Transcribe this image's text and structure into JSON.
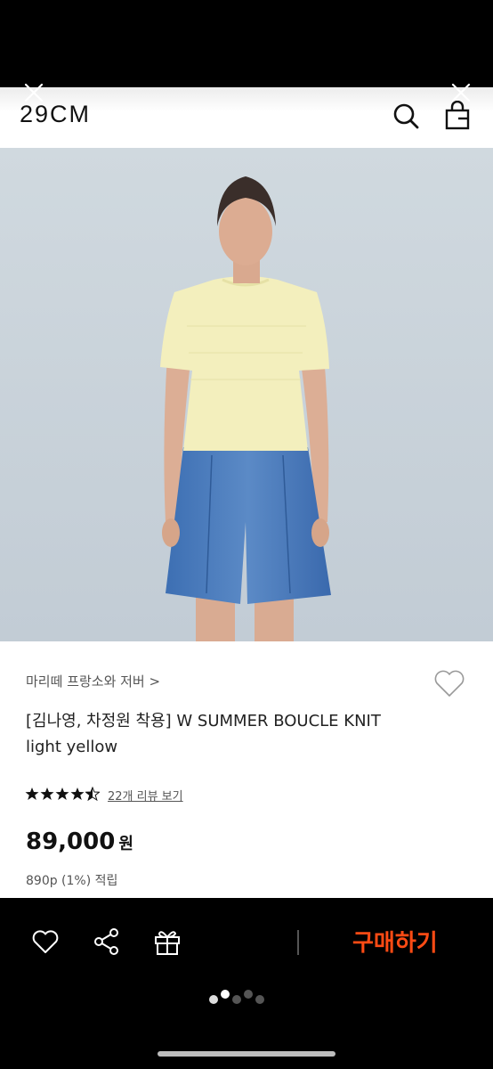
{
  "header": {
    "logo": "29CM"
  },
  "icons": {
    "close_left": "close-icon",
    "close_right": "close-icon",
    "search": "search-icon",
    "bag": "shopping-bag-icon",
    "wishlist": "heart-icon",
    "share": "share-icon",
    "gift": "gift-icon"
  },
  "product": {
    "brand": "마리떼 프랑소와 저버 >",
    "title_line1": "[김나영, 차정원 착용] W SUMMER BOUCLE KNIT",
    "title_line2": "light yellow",
    "rating": 4.5,
    "rating_max": 5,
    "review_link": "22개 리뷰 보기",
    "price": "89,000",
    "price_unit": "원",
    "points": "890p (1%) 적립"
  },
  "bottom_bar": {
    "buy_label": "구매하기"
  },
  "carousel": {
    "count": 5,
    "active_index": 1
  },
  "colors": {
    "accent": "#ff4b14",
    "background": "#000000",
    "card": "#ffffff"
  }
}
